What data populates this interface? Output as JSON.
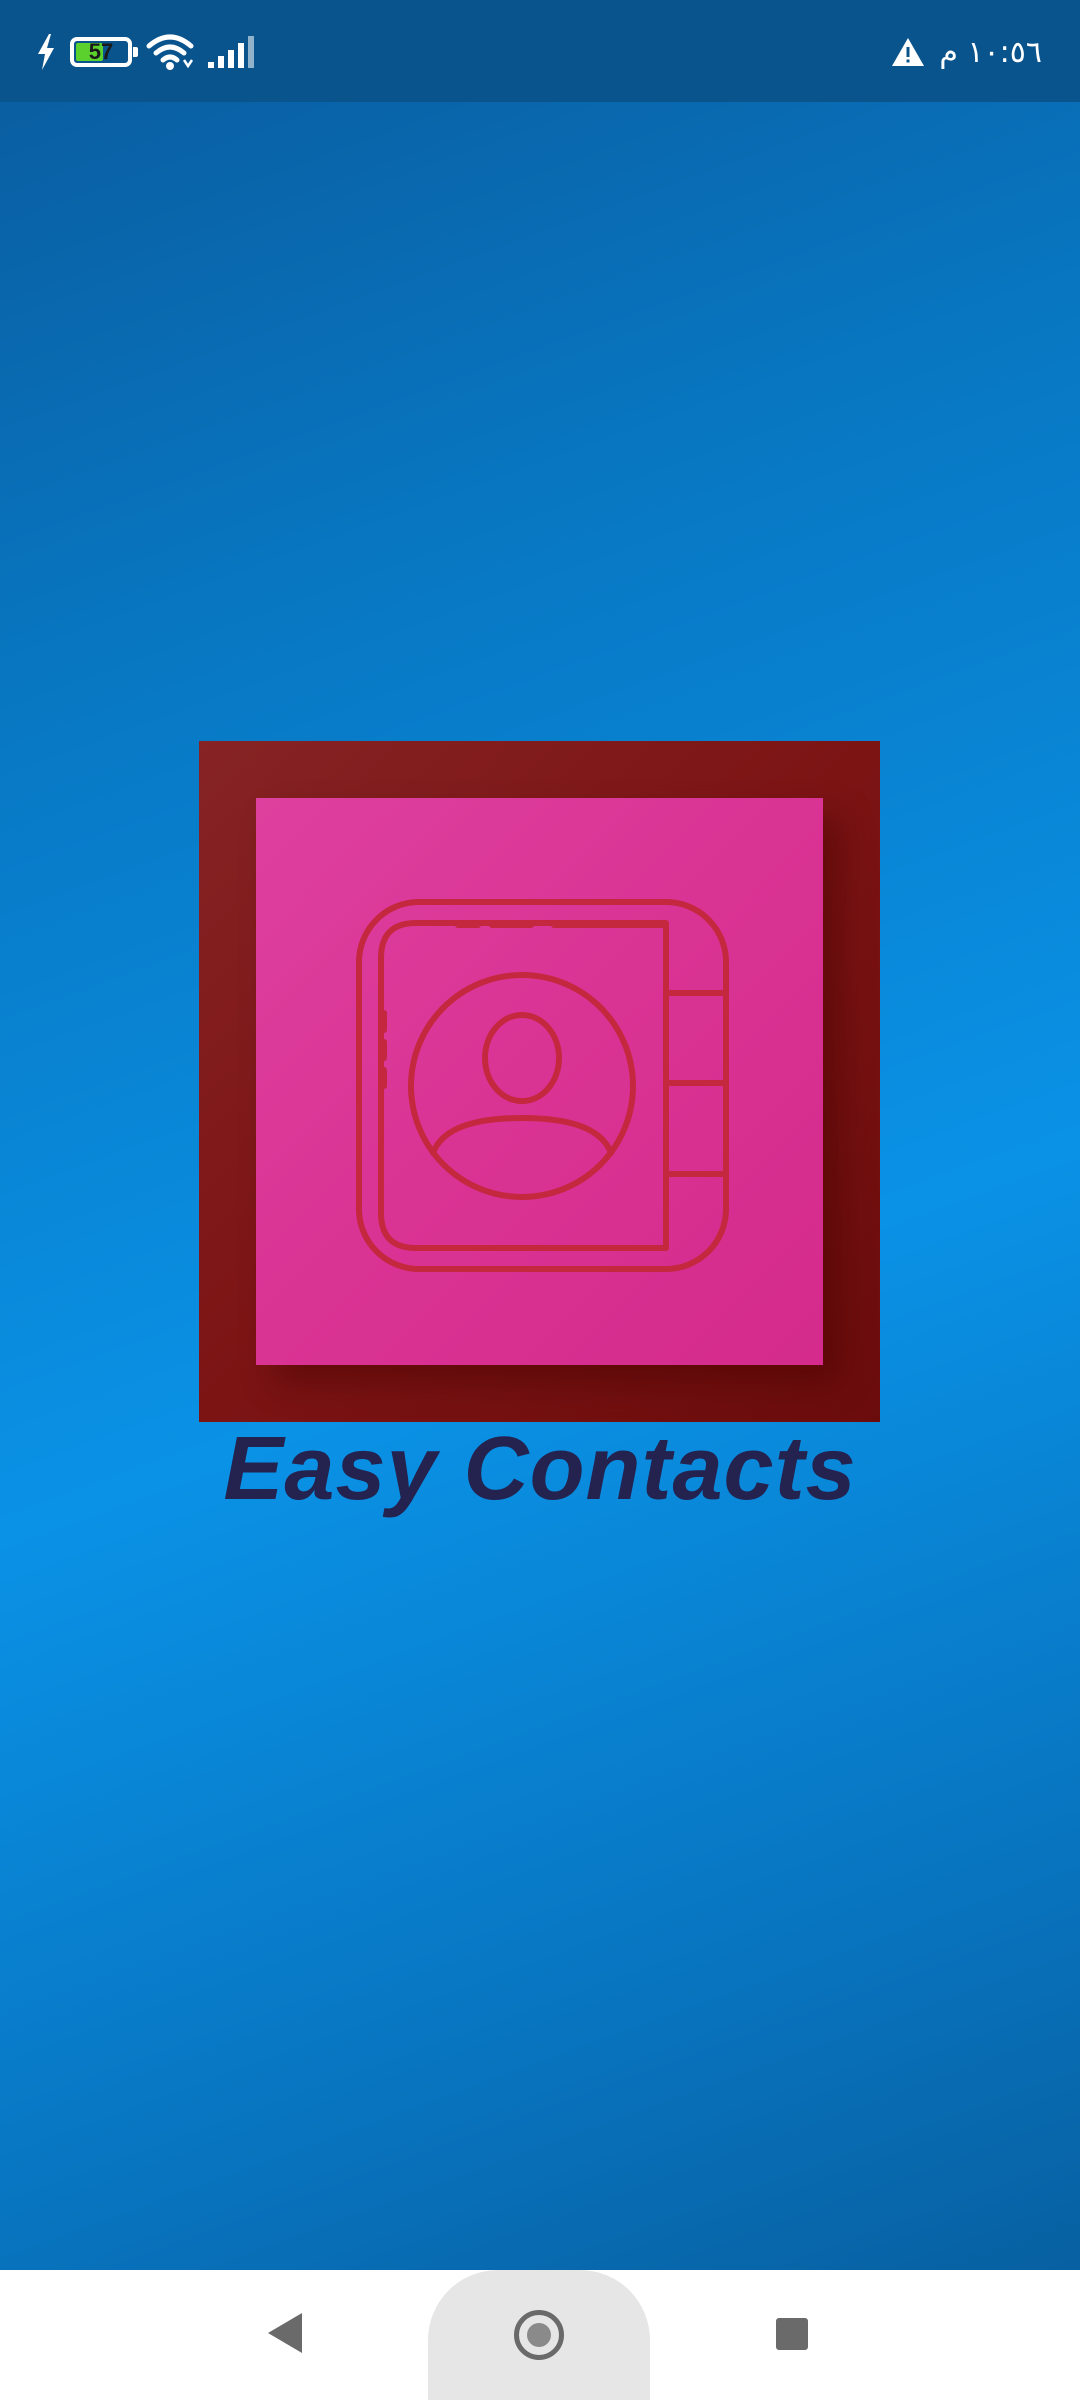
{
  "status_bar": {
    "battery_level": "57",
    "battery_fraction": 0.57,
    "clock": "١٠:٥٦ م",
    "icons": [
      "charging-bolt-icon",
      "battery-icon",
      "wifi-icon",
      "signal-icon",
      "warning-icon"
    ]
  },
  "app": {
    "title": "Easy Contacts",
    "logo_icon": "contact-book-icon"
  },
  "navigation": {
    "icons": [
      "back-icon",
      "home-icon",
      "recent-apps-icon"
    ]
  },
  "colors": {
    "background": "#0a92e6",
    "status_bar": "#0a548d",
    "logo_frame": "#7c1414",
    "logo_tile": "#d93394",
    "icon_stroke": "#c4283f",
    "title_text": "#24224f",
    "battery_fill": "#5bd12d"
  }
}
